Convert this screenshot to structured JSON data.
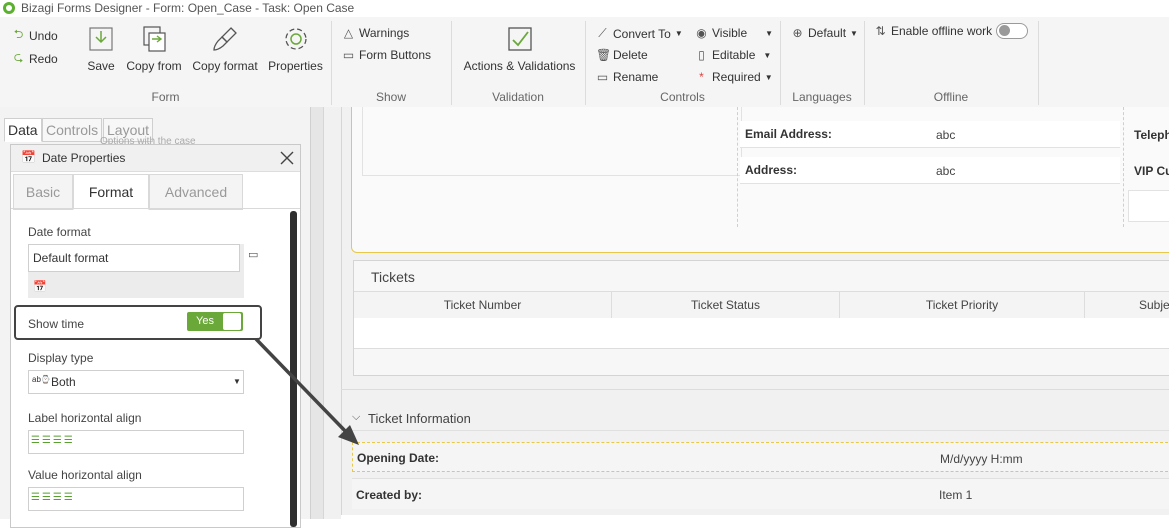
{
  "window": {
    "title": "Bizagi Forms Designer  - Form: Open_Case - Task:  Open Case"
  },
  "ribbon": {
    "undo": "Undo",
    "redo": "Redo",
    "save": "Save",
    "copy_from": "Copy from",
    "copy_format": "Copy format",
    "properties": "Properties",
    "group_form": "Form",
    "warnings": "Warnings",
    "form_buttons": "Form Buttons",
    "group_show": "Show",
    "actions_validations": "Actions & Validations",
    "group_validation": "Validation",
    "convert_to": "Convert To",
    "delete": "Delete",
    "rename": "Rename",
    "visible": "Visible",
    "editable": "Editable",
    "required": "Required",
    "group_controls": "Controls",
    "default_lang": "Default",
    "group_languages": "Languages",
    "enable_offline": "Enable offline work",
    "group_offline": "Offline"
  },
  "left_tabs": {
    "data": "Data",
    "controls": "Controls",
    "layout": "Layout"
  },
  "behind_text": "Options with the case",
  "dialog": {
    "title": "Date Properties",
    "tabs": {
      "basic": "Basic",
      "format": "Format",
      "advanced": "Advanced"
    },
    "date_format_label": "Date format",
    "date_format_value": "Default format",
    "show_time_label": "Show time",
    "show_time_value": "Yes",
    "display_type_label": "Display type",
    "display_type_value": "Both",
    "label_align_label": "Label horizontal align",
    "value_align_label": "Value horizontal align"
  },
  "form": {
    "email_label": "Email Address:",
    "email_value": "abc",
    "address_label": "Address:",
    "address_value": "abc",
    "teleph_label": "Teleph",
    "vip_label": "VIP Cu",
    "tickets_title": "Tickets",
    "columns": [
      "Ticket Number",
      "Ticket Status",
      "Ticket Priority",
      "Subje"
    ],
    "ticket_info_title": "Ticket Information",
    "opening_date_label": "Opening Date:",
    "opening_date_value": "M/d/yyyy H:mm",
    "created_by_label": "Created by:",
    "created_by_value": "Item 1"
  },
  "colors": {
    "accent_green": "#6ba83a",
    "highlight_yellow": "#e8c84a",
    "callout": "#444444"
  }
}
